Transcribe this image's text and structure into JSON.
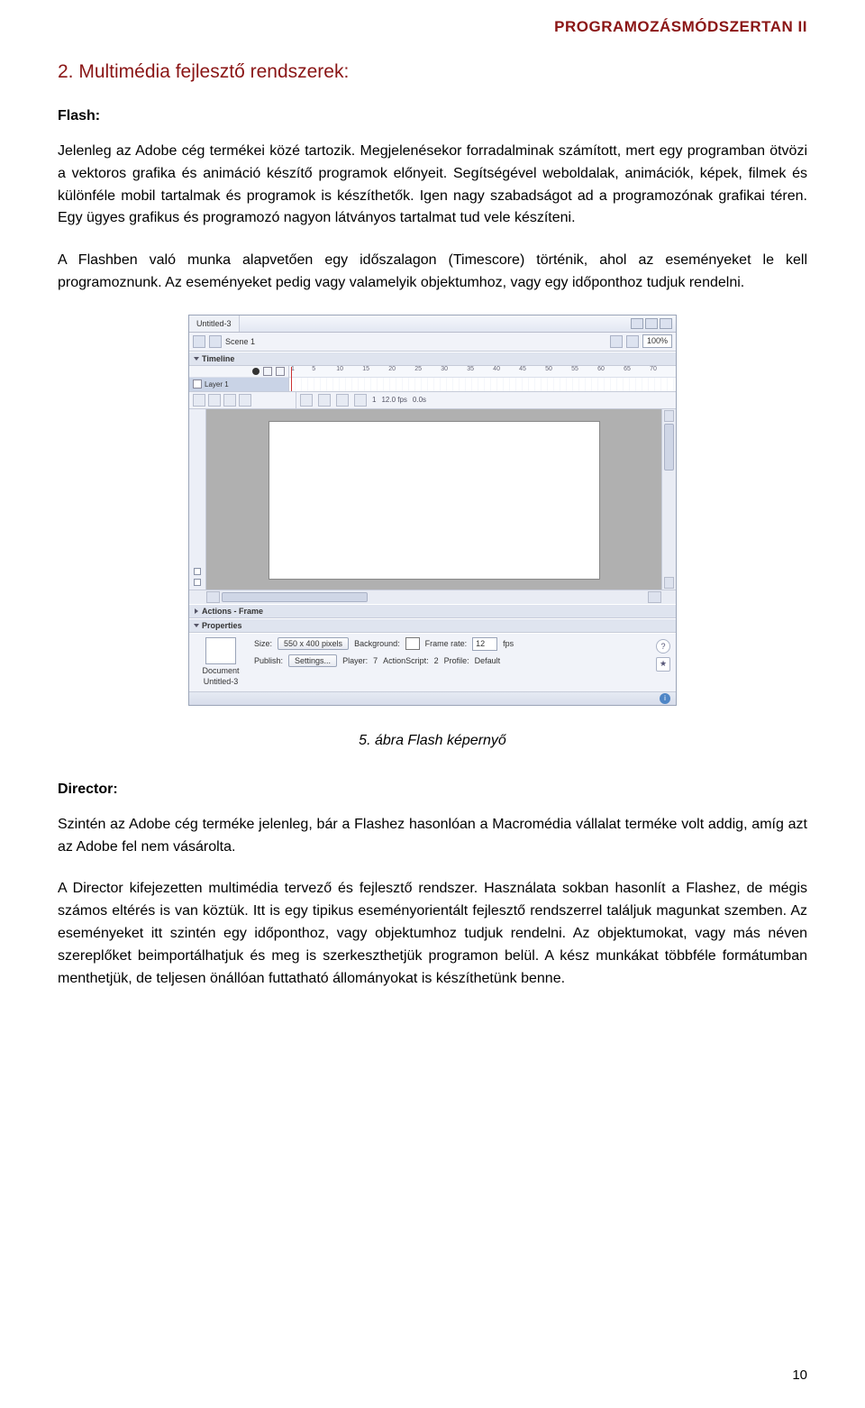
{
  "header": {
    "running_title": "PROGRAMOZÁSMÓDSZERTAN II"
  },
  "section": {
    "title": "2. Multimédia fejlesztő rendszerek:",
    "flash_label": "Flash:",
    "flash_p1": "Jelenleg az Adobe cég termékei közé tartozik. Megjelenésekor forradalminak számított, mert egy programban ötvözi a vektoros grafika és animáció készítő programok előnyeit. Segítségével weboldalak, animációk, képek, filmek és különféle mobil tartalmak és programok is készíthetők. Igen nagy szabadságot ad a programozónak grafikai téren. Egy ügyes grafikus és programozó nagyon látványos tartalmat tud vele készíteni.",
    "flash_p2": "A Flashben való munka alapvetően egy időszalagon (Timescore) történik, ahol az eseményeket le kell programoznunk. Az eseményeket pedig vagy valamelyik objektumhoz, vagy egy időponthoz tudjuk rendelni.",
    "figure_caption": "5. ábra Flash képernyő",
    "director_label": "Director:",
    "director_p1": "Szintén az Adobe cég terméke jelenleg, bár a Flashez hasonlóan a Macromédia vállalat terméke volt addig, amíg azt az Adobe fel nem vásárolta.",
    "director_p2": "A Director kifejezetten multimédia tervező és fejlesztő rendszer. Használata sokban hasonlít a Flashez, de mégis számos eltérés is van köztük. Itt is egy tipikus eseményorientált fejlesztő rendszerrel találjuk magunkat szemben. Az eseményeket itt szintén egy időponthoz, vagy objektumhoz tudjuk rendelni. Az objektumokat, vagy más néven szereplőket beimportálhatjuk és meg is szerkeszthetjük programon belül. A kész munkákat többféle formátumban menthetjük, de teljesen önállóan futtatható állományokat is készíthetünk benne."
  },
  "page_number": "10",
  "app": {
    "tab_title": "Untitled-3",
    "scene_label": "Scene 1",
    "zoom": "100%",
    "timeline_label": "Timeline",
    "layer_name": "Layer 1",
    "ruler_ticks": [
      "1",
      "5",
      "10",
      "15",
      "20",
      "25",
      "30",
      "35",
      "40",
      "45",
      "50",
      "55",
      "60",
      "65",
      "70"
    ],
    "frame_readout": "1",
    "fps_readout": "12.0 fps",
    "time_readout": "0.0s",
    "actions_label": "Actions - Frame",
    "properties_label": "Properties",
    "doc_label": "Document",
    "doc_name": "Untitled-3",
    "size_label": "Size:",
    "size_btn": "550 x 400 pixels",
    "background_label": "Background:",
    "framerate_label": "Frame rate:",
    "framerate_value": "12",
    "fps_suffix": "fps",
    "publish_label": "Publish:",
    "settings_btn": "Settings...",
    "player_label": "Player:",
    "player_value": "7",
    "as_label": "ActionScript:",
    "as_value": "2",
    "profile_label": "Profile:",
    "profile_value": "Default"
  }
}
